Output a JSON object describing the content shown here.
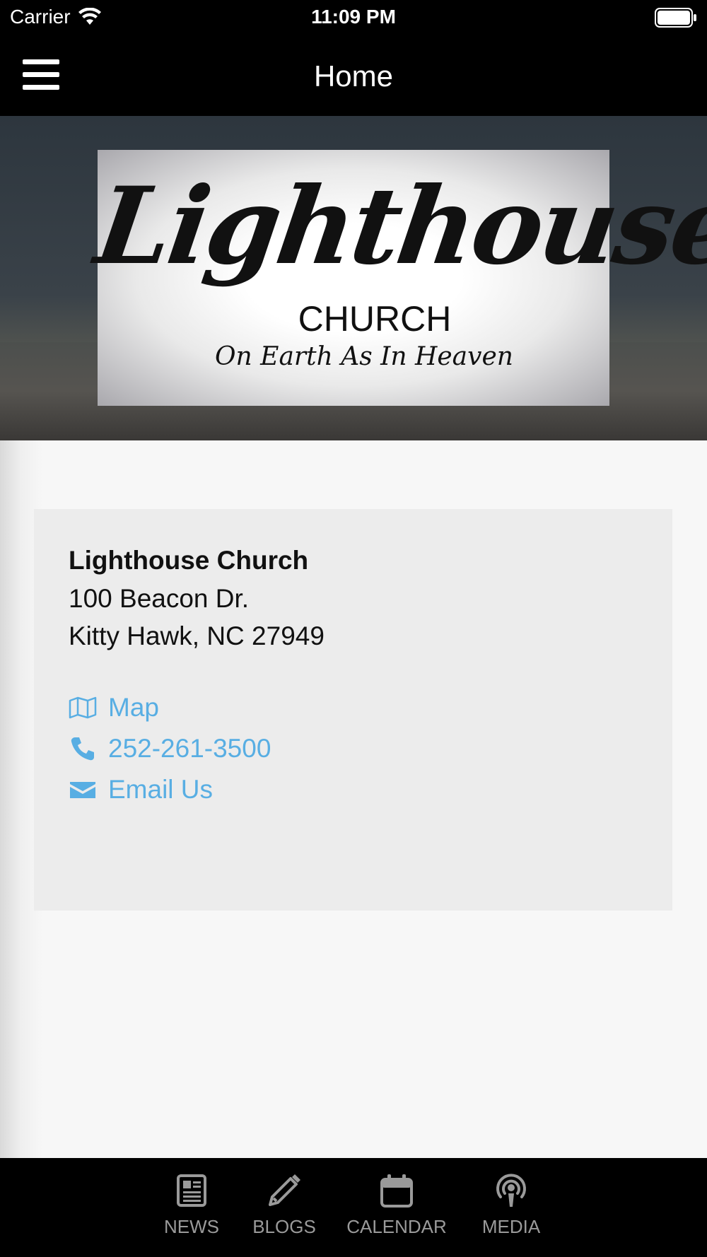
{
  "status_bar": {
    "carrier": "Carrier",
    "time": "11:09 PM"
  },
  "nav": {
    "title": "Home"
  },
  "hero": {
    "logo_script": "Lighthouse",
    "logo_church": "CHURCH",
    "logo_tagline": "On Earth As In Heaven"
  },
  "info": {
    "name": "Lighthouse Church",
    "address_line1": "100 Beacon Dr.",
    "address_line2": "Kitty Hawk, NC 27949",
    "map_label": "Map",
    "phone_label": "252-261-3500",
    "email_label": "Email Us",
    "link_color": "#58aee3"
  },
  "tabs": [
    {
      "label": "NEWS",
      "icon": "newspaper-icon"
    },
    {
      "label": "BLOGS",
      "icon": "pencil-icon"
    },
    {
      "label": "CALENDAR",
      "icon": "calendar-icon"
    },
    {
      "label": "MEDIA",
      "icon": "podcast-icon"
    }
  ]
}
